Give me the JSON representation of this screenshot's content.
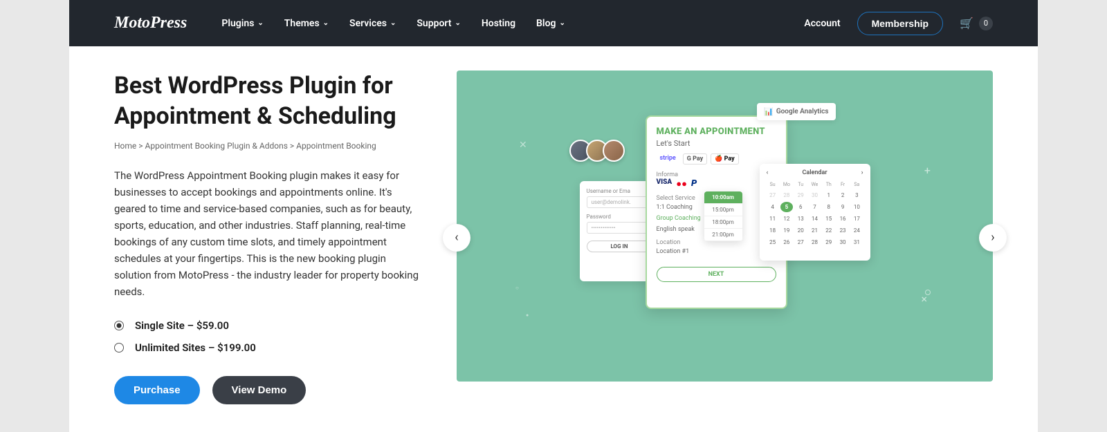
{
  "header": {
    "logo_text": "MotoPress",
    "nav": [
      {
        "label": "Plugins",
        "dropdown": true
      },
      {
        "label": "Themes",
        "dropdown": true
      },
      {
        "label": "Services",
        "dropdown": true
      },
      {
        "label": "Support",
        "dropdown": true
      },
      {
        "label": "Hosting",
        "dropdown": false
      },
      {
        "label": "Blog",
        "dropdown": true
      }
    ],
    "account_label": "Account",
    "membership_label": "Membership",
    "cart_count": "0"
  },
  "page": {
    "title": "Best WordPress Plugin for Appointment & Scheduling",
    "breadcrumb": {
      "home": "Home",
      "sep": ">",
      "mid": "Appointment Booking Plugin & Addons",
      "current": "Appointment Booking"
    },
    "description": "The WordPress Appointment Booking plugin makes it easy for businesses to accept bookings and appointments online. It's geared to time and service-based companies, such as for beauty, sports, education, and other industries. Staff planning, real-time bookings of any custom time slots, and timely appointment schedules at your fingertips. This is the new booking plugin solution from MotoPress - the industry leader for property booking needs.",
    "pricing": [
      {
        "label": "Single Site – $59.00",
        "selected": true
      },
      {
        "label": "Unlimited Sites – $199.00",
        "selected": false
      }
    ],
    "purchase_label": "Purchase",
    "demo_label": "View Demo"
  },
  "mockup": {
    "ga_label": "Google Analytics",
    "main": {
      "title": "MAKE AN APPOINTMENT",
      "sub": "Let's Start",
      "info_label": "Informa",
      "pay_methods_top": [
        "stripe",
        "G Pay",
        "🍎 Pay"
      ],
      "pay_methods_bottom": [
        "VISA",
        "●●",
        "P"
      ],
      "select_service_label": "Select Service",
      "services": [
        "1:1 Coaching",
        "Group Coaching",
        "English speak"
      ],
      "location_label": "Location",
      "location_value": "Location #1",
      "next": "NEXT"
    },
    "login": {
      "username_label": "Username or Ema",
      "username_value": "user@demolink.",
      "password_label": "Password",
      "password_value": "•••••••••••••",
      "button": "LOG IN"
    },
    "times": [
      "10:00am",
      "15:00pm",
      "18:00pm",
      "21:00pm"
    ],
    "calendar": {
      "title": "Calendar",
      "days": [
        "Su",
        "Mo",
        "Tu",
        "We",
        "Th",
        "Fr",
        "Sa"
      ],
      "grid": [
        [
          "27",
          "28",
          "29",
          "30",
          "1",
          "2",
          "3"
        ],
        [
          "4",
          "5",
          "6",
          "7",
          "8",
          "9",
          "10"
        ],
        [
          "11",
          "12",
          "13",
          "14",
          "15",
          "16",
          "17"
        ],
        [
          "18",
          "19",
          "20",
          "21",
          "22",
          "23",
          "24"
        ],
        [
          "25",
          "26",
          "27",
          "28",
          "29",
          "30",
          "31"
        ]
      ],
      "selected": "5"
    }
  }
}
